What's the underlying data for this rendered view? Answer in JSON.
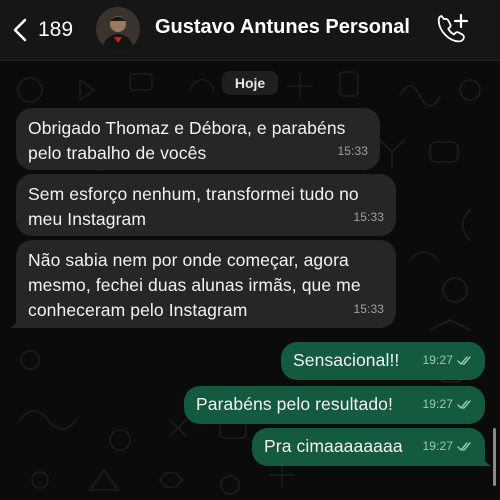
{
  "header": {
    "back_count": "189",
    "contact_name": "Gustavo Antunes Personal"
  },
  "chat": {
    "day_label": "Hoje",
    "messages": [
      {
        "direction": "incoming",
        "text": "Obrigado Thomaz e Débora, e parabéns\npelo trabalho de vocês",
        "time": "15:33"
      },
      {
        "direction": "incoming",
        "text": "Sem esforço nenhum, transformei tudo no\nmeu Instagram",
        "time": "15:33"
      },
      {
        "direction": "incoming",
        "text": "Não sabia nem por onde começar, agora\nmesmo, fechei duas alunas irmãs, que me\nconheceram pelo Instagram",
        "time": "15:33"
      },
      {
        "direction": "outgoing",
        "text": "Sensacional!!",
        "time": "19:27",
        "status": "read"
      },
      {
        "direction": "outgoing",
        "text": "Parabéns pelo resultado!",
        "time": "19:27",
        "status": "read"
      },
      {
        "direction": "outgoing",
        "text": "Pra cimaaaaaaaa",
        "time": "19:27",
        "status": "read"
      }
    ]
  },
  "icons": {
    "back": "chevron-left-icon",
    "call": "add-call-icon",
    "read_status": "double-check-icon"
  },
  "colors": {
    "background": "#0b0b0b",
    "header": "#161616",
    "incoming_bubble": "#262628",
    "outgoing_bubble": "#145a3e",
    "text": "#f2f2f2",
    "tick": "#9fc7b5"
  }
}
